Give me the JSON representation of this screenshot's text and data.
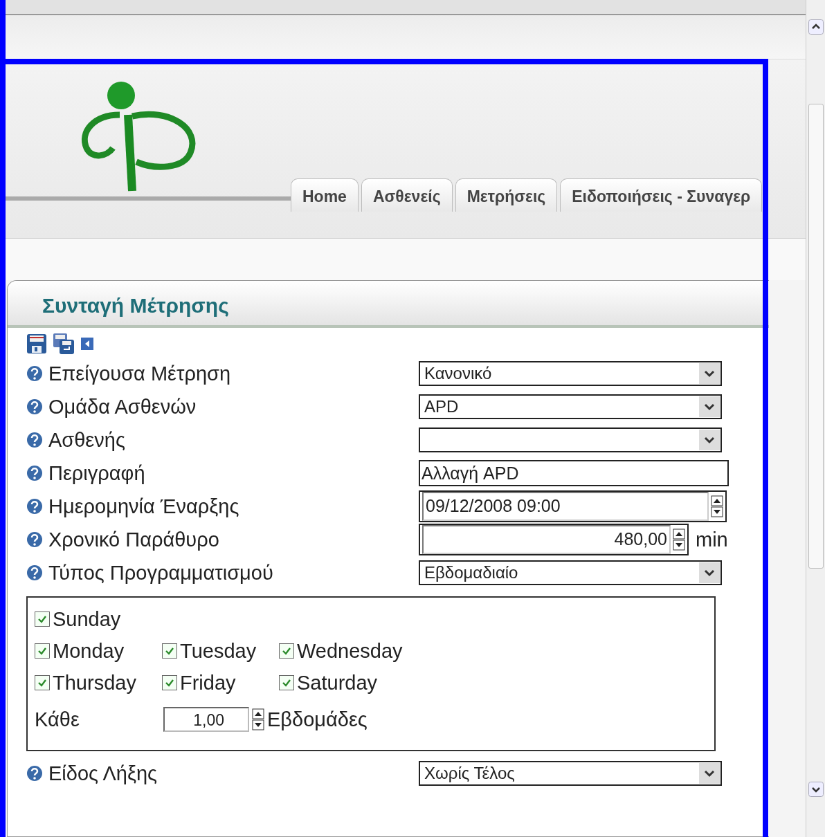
{
  "nav_tabs": [
    "Home",
    "Ασθενείς",
    "Μετρήσεις",
    "Ειδοποιήσεις - Συναγερ"
  ],
  "panel": {
    "title": "Συνταγή Μέτρησης"
  },
  "fields": [
    {
      "label": "Επείγουσα Μέτρηση",
      "kind": "select",
      "value": "Κανονικό"
    },
    {
      "label": "Ομάδα Ασθενών",
      "kind": "select",
      "value": "APD"
    },
    {
      "label": "Ασθενής",
      "kind": "select"
    },
    {
      "label": "Περιγραφή",
      "kind": "text",
      "value": "Αλλαγή APD"
    },
    {
      "label": "Ημερομηνία Έναρξης",
      "kind": "datetime",
      "value": "09/12/2008 09:00"
    },
    {
      "label": "Χρονικό Παράθυρο",
      "kind": "number",
      "value": "480,00",
      "unit": "min"
    },
    {
      "label": "Τύπος Προγραμματισμού",
      "kind": "select",
      "value": "Εβδομαδιαίο"
    }
  ],
  "day_rows": [
    [
      {
        "label": "Sunday",
        "checked": true
      }
    ],
    [
      {
        "label": "Monday",
        "checked": true
      },
      {
        "label": "Tuesday",
        "checked": true
      },
      {
        "label": "Wednesday",
        "checked": true
      }
    ],
    [
      {
        "label": "Thursday",
        "checked": true
      },
      {
        "label": "Friday",
        "checked": true
      },
      {
        "label": "Saturday",
        "checked": true
      }
    ]
  ],
  "repeat": {
    "label": "Κάθε",
    "value": "1,00",
    "unit": "Εβδομάδες"
  },
  "end_field": {
    "label": "Είδος Λήξης",
    "kind": "select",
    "value": "Χωρίς Τέλος"
  }
}
